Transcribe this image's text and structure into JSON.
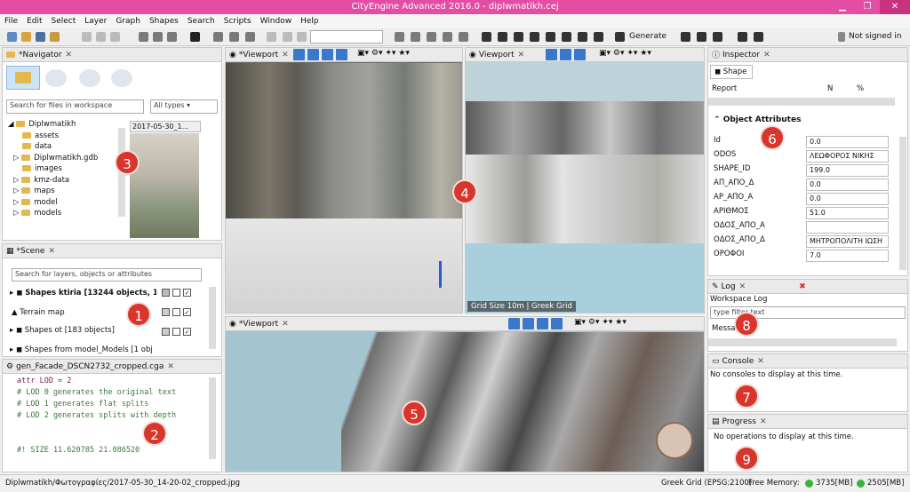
{
  "title": "CityEngine Advanced 2016.0 - diplwmatikh.cej",
  "menu": [
    "File",
    "Edit",
    "Select",
    "Layer",
    "Graph",
    "Shapes",
    "Search",
    "Scripts",
    "Window",
    "Help"
  ],
  "toolbar": {
    "generate": "Generate",
    "signin": "Not signed in"
  },
  "navigator": {
    "tab": "*Navigator",
    "search_placeholder": "Search for files in workspace",
    "filter": "All types",
    "root": "Diplwmatikh",
    "items": [
      "assets",
      "data",
      "Diplwmatikh.gdb",
      "images",
      "kmz-data",
      "maps",
      "model",
      "models"
    ],
    "preview_label": "2017-05-30_1..."
  },
  "scene": {
    "tab": "*Scene",
    "search_placeholder": "Search for layers, objects or attributes",
    "layers": [
      "Shapes ktiria [13244 objects, 1 se",
      "Terrain map",
      "Shapes ot [183 objects]",
      "Shapes from model_Models [1 obj"
    ]
  },
  "editor": {
    "tab": "gen_Facade_DSCN2732_cropped.cga",
    "lines": [
      "attr LOD = 2",
      "# LOD 0 generates the original text",
      "# LOD 1 generates flat splits",
      "# LOD 2 generates splits with depth",
      "",
      "",
      "#! SIZE 11.620785 21.086520"
    ]
  },
  "viewports": {
    "tab1": "*Viewport",
    "tab2": "Viewport",
    "tab3": "*Viewport",
    "grid_info": "Grid Size 10m  |  Greek Grid"
  },
  "inspector": {
    "tab": "Inspector",
    "shape_tab": "Shape",
    "report_cols": [
      "Report",
      "N",
      "%"
    ],
    "section": "Object Attributes",
    "attrs": [
      {
        "k": "Id",
        "v": "0.0"
      },
      {
        "k": "ODOS",
        "v": "ΛΕΩΦΟΡΟΣ ΝΙΚΗΣ"
      },
      {
        "k": "SHAPE_ID",
        "v": "199.0"
      },
      {
        "k": "ΑΠ_ΑΠΟ_Δ",
        "v": "0.0"
      },
      {
        "k": "ΑΡ_ΑΠΟ_Α",
        "v": "0.0"
      },
      {
        "k": "ΑΡΙΘΜΟΣ",
        "v": "51.0"
      },
      {
        "k": "ΟΔΟΣ_ΑΠΟ_Α",
        "v": ""
      },
      {
        "k": "ΟΔΟΣ_ΑΠΟ_Δ",
        "v": "ΜΗΤΡΟΠΟΛΙΤΗ ΙΩΣΗ"
      },
      {
        "k": "ΟΡΟΦΟΙ",
        "v": "7.0"
      }
    ]
  },
  "log": {
    "tab": "Log",
    "title": "Workspace Log",
    "filter_placeholder": "type filter text",
    "msg_col": "Message"
  },
  "console": {
    "tab": "Console",
    "msg": "No consoles to display at this time."
  },
  "progress": {
    "tab": "Progress",
    "msg": "No operations to display at this time."
  },
  "badges": [
    "1",
    "2",
    "3",
    "4",
    "5",
    "6",
    "7",
    "8",
    "9"
  ],
  "status": {
    "path": "Diplwmatikh/Φωτογραφίες/2017-05-30_14-20-02_cropped.jpg",
    "grid": "Greek Grid (EPSG:2100)",
    "memlabel": "Free Memory:",
    "mem1": "3735[MB]",
    "mem2": "2505[MB]"
  }
}
